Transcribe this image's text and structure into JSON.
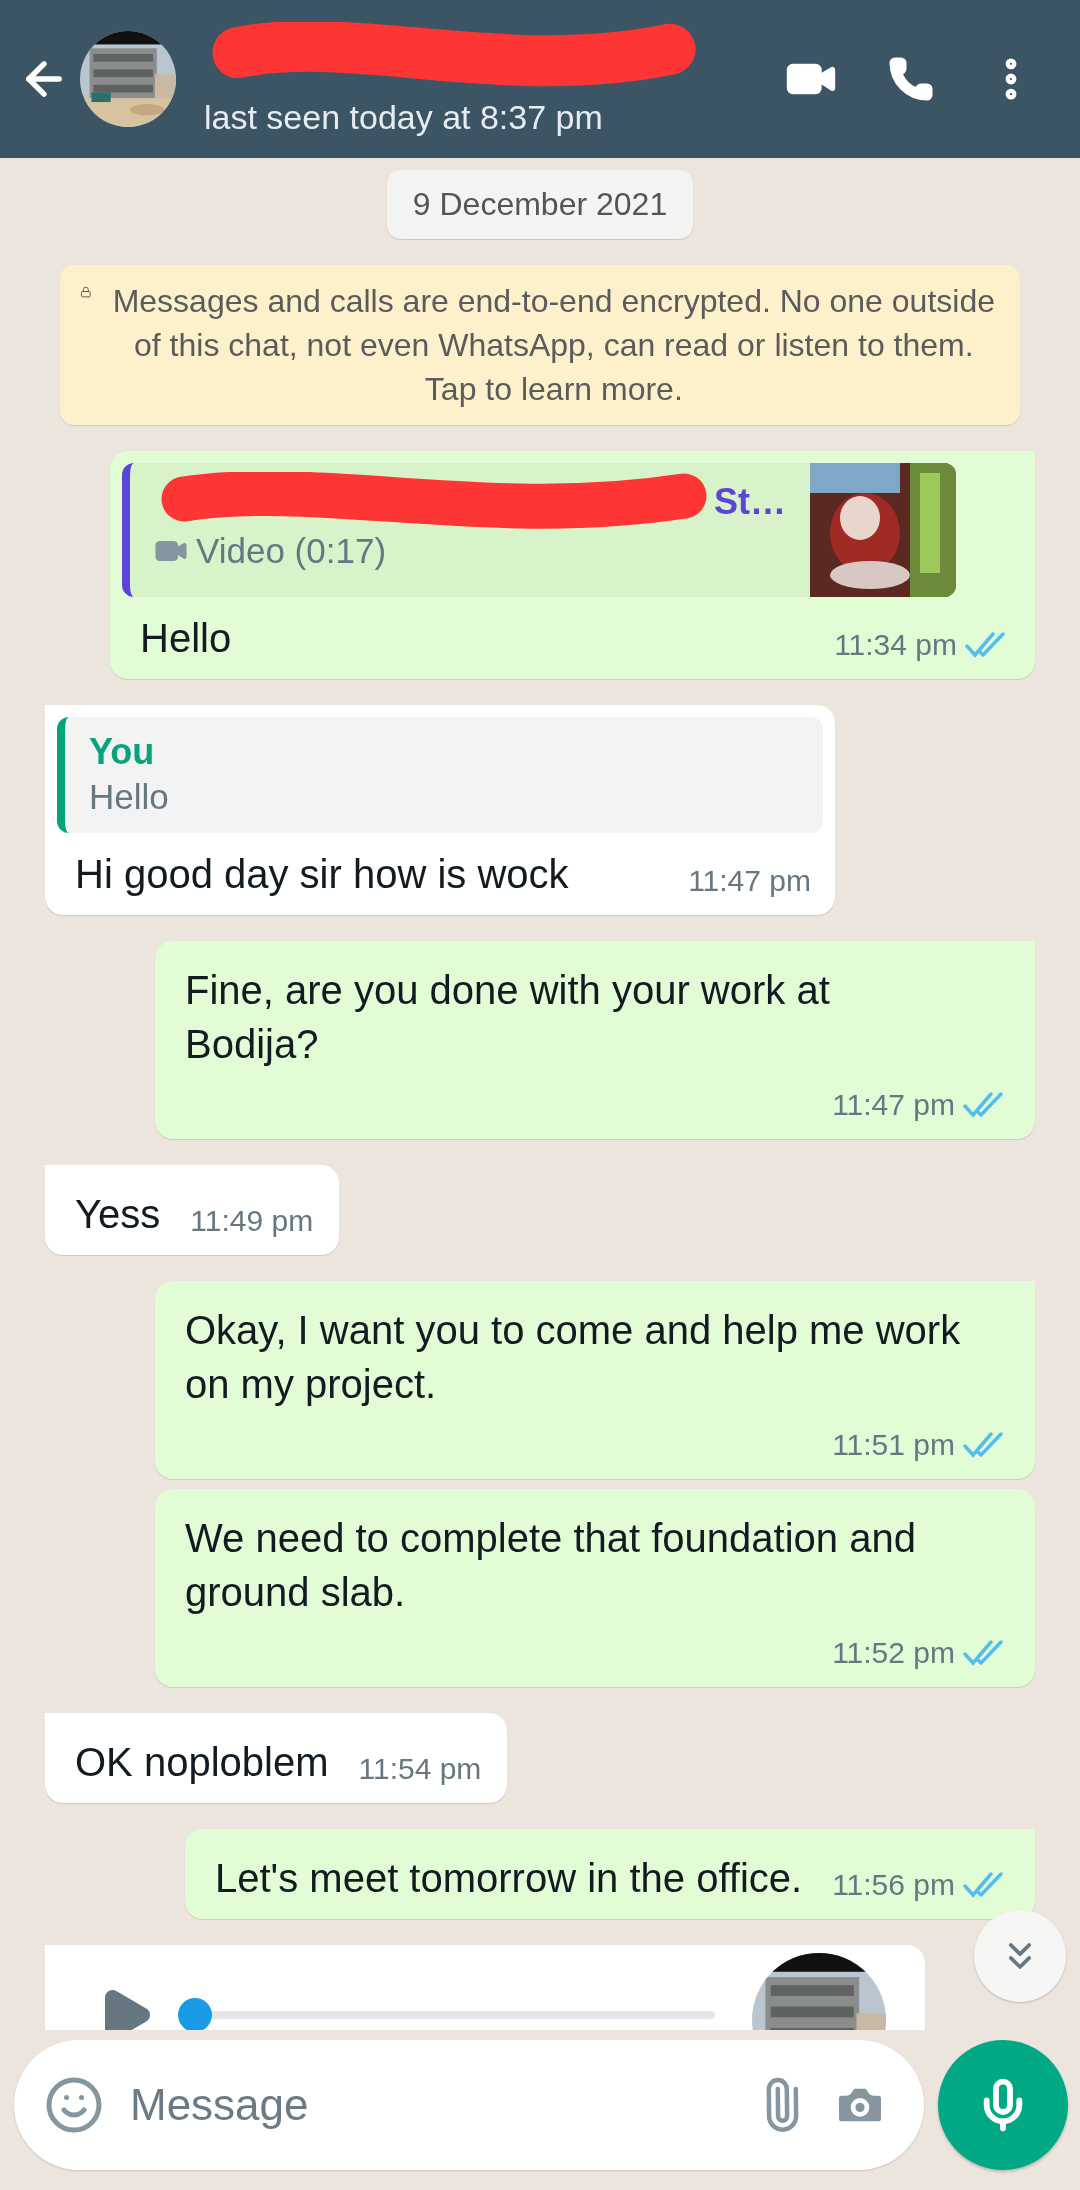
{
  "header": {
    "subtitle": "last seen today at 8:37 pm"
  },
  "date_chip": "9 December 2021",
  "encryption_notice": "Messages and calls are end-to-end encrypted. No one outside of this chat, not even WhatsApp, can read or listen to them. Tap to learn more.",
  "messages": [
    {
      "kind": "out_video_quote",
      "quote_title_end": "St…",
      "quote_text": "Video (0:17)",
      "text": "Hello",
      "time": "11:34 pm",
      "read": true,
      "tail": true
    },
    {
      "kind": "in_quote",
      "quote_author": "You",
      "quote_text": "Hello",
      "text": "Hi good day sir how is wock",
      "time": "11:47 pm",
      "tail": true
    },
    {
      "kind": "out",
      "text": "Fine, are you done with your work at Bodija?",
      "time": "11:47 pm",
      "read": true,
      "tail": true
    },
    {
      "kind": "in",
      "text": "Yess",
      "time": "11:49 pm",
      "tail": true
    },
    {
      "kind": "out",
      "text": "Okay, I want you to come and help me work on my project.",
      "time": "11:51 pm",
      "read": true,
      "tail": true
    },
    {
      "kind": "out",
      "text": "We need to complete that foundation and ground slab.",
      "time": "11:52 pm",
      "read": true,
      "tail": false
    },
    {
      "kind": "in",
      "text": "OK noploblem",
      "time": "11:54 pm",
      "tail": true
    },
    {
      "kind": "out",
      "text": "Let's meet tomorrow in the office.",
      "time": "11:56 pm",
      "read": true,
      "tail": true
    },
    {
      "kind": "voice",
      "level": 0,
      "tail": true
    }
  ],
  "composer": {
    "placeholder": "Message"
  }
}
